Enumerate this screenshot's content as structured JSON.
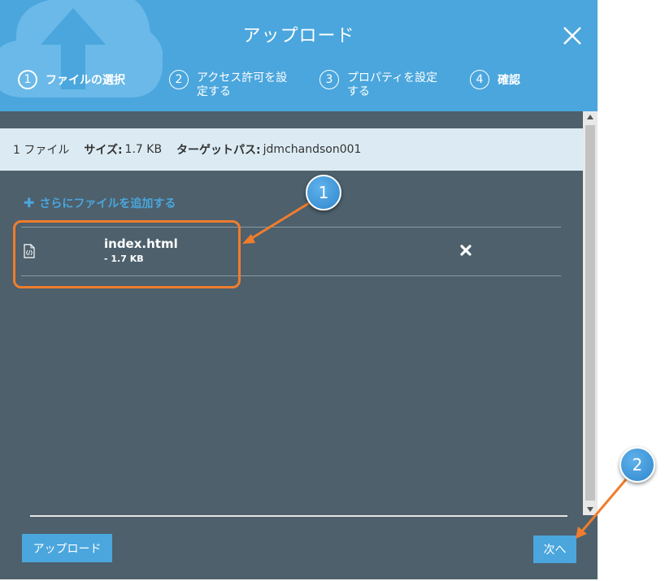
{
  "dialog": {
    "title": "アップロード",
    "steps": [
      {
        "num": "1",
        "label": "ファイルの選択",
        "active": true
      },
      {
        "num": "2",
        "label": "アクセス許可を設定する",
        "active": false
      },
      {
        "num": "3",
        "label": "プロパティを設定する",
        "active": false
      },
      {
        "num": "4",
        "label": "確認",
        "active": false
      }
    ],
    "close_icon": "close-icon"
  },
  "infobar": {
    "file_count": "1 ファイル",
    "size_label": "サイズ:",
    "size_value": "1.7 KB",
    "target_label": "ターゲットパス:",
    "target_value": "jdmchandson001"
  },
  "add_more": {
    "icon": "plus-icon",
    "label": "さらにファイルを追加する"
  },
  "files": [
    {
      "icon": "html-file-icon",
      "name": "index.html",
      "size": "- 1.7 KB",
      "remove_icon": "remove-icon"
    }
  ],
  "footer": {
    "upload_label": "アップロード",
    "next_label": "次へ"
  },
  "callouts": {
    "one": "1",
    "two": "2"
  },
  "colors": {
    "accent": "#4aa6dd",
    "dialog_bg": "#4d606c",
    "highlight": "#ef7d2d",
    "infobar_bg": "#dcebf3"
  }
}
